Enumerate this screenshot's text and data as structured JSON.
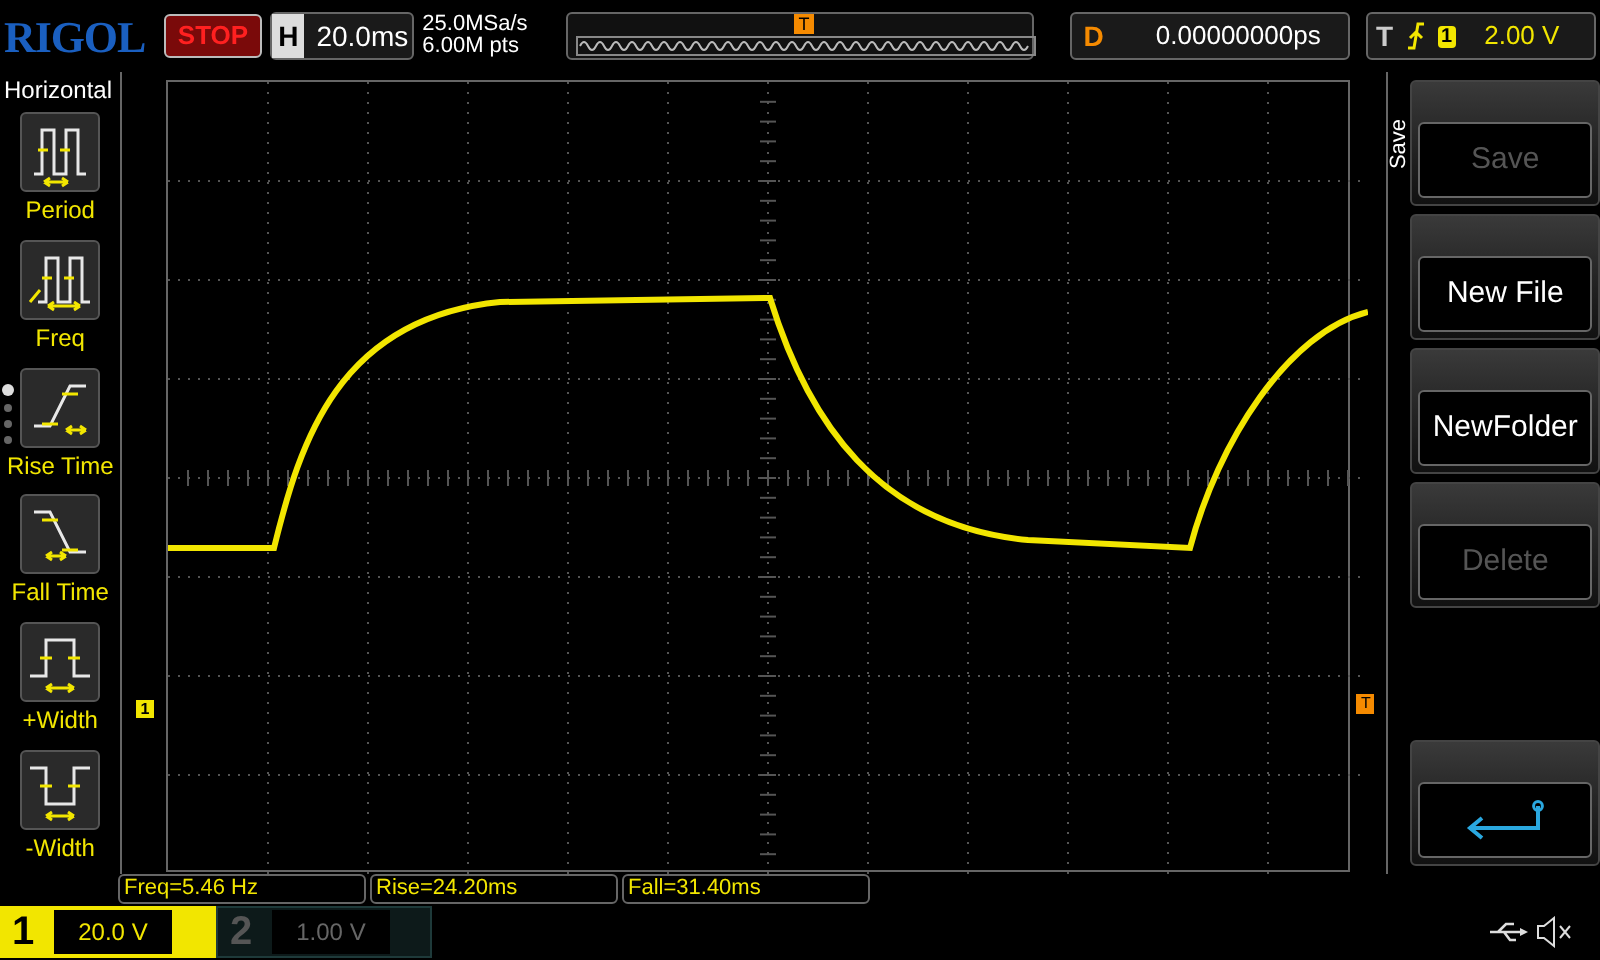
{
  "brand": "RIGOL",
  "run_state": "STOP",
  "timebase": {
    "label": "H",
    "value": "20.0ms"
  },
  "acquisition": {
    "sample_rate": "25.0MSa/s",
    "memory_depth": "6.00M pts"
  },
  "trigger_position_marker": "T",
  "delay": {
    "label": "D",
    "value": "0.00000000ps"
  },
  "trigger": {
    "label": "T",
    "channel": "1",
    "level": "2.00 V"
  },
  "left_menu": {
    "title": "Horizontal",
    "items": [
      {
        "kind": "period",
        "label": "Period"
      },
      {
        "kind": "freq",
        "label": "Freq"
      },
      {
        "kind": "rise",
        "label": "Rise Time"
      },
      {
        "kind": "fall",
        "label": "Fall Time"
      },
      {
        "kind": "pwidth",
        "label": "+Width"
      },
      {
        "kind": "nwidth",
        "label": "-Width"
      }
    ],
    "pages": [
      {
        "selected": true
      },
      {
        "selected": false
      },
      {
        "selected": false
      },
      {
        "selected": false
      }
    ]
  },
  "channel_marker": "1",
  "trigger_level_marker": "T",
  "right_menu": {
    "title": "Save",
    "buttons": [
      {
        "kind": "text",
        "label": "Save",
        "disabled": true
      },
      {
        "kind": "text",
        "label": "New File",
        "disabled": false
      },
      {
        "kind": "text",
        "label": "NewFolder",
        "disabled": false
      },
      {
        "kind": "text",
        "label": "Delete",
        "disabled": true
      },
      {
        "kind": "back",
        "disabled": false
      }
    ]
  },
  "measurements": [
    "Freq=5.46 Hz",
    "Rise=24.20ms",
    "Fall=31.40ms"
  ],
  "channels": [
    {
      "number": "1",
      "scale": "20.0 V",
      "on": true
    },
    {
      "number": "2",
      "scale": "1.00 V",
      "on": false
    }
  ]
}
